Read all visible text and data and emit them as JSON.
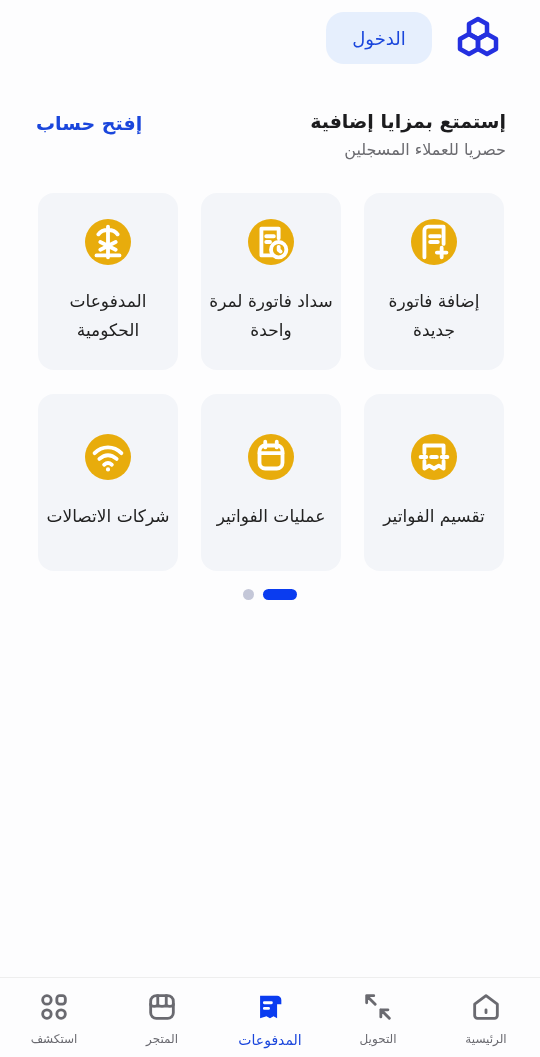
{
  "header": {
    "login_button": "الدخول"
  },
  "promo": {
    "title": "إستمتع بمزايا إضافية",
    "subtitle": "حصريا للعملاء المسجلين",
    "link": "إفتح حساب"
  },
  "services": [
    {
      "label": "إضافة فاتورة جديدة"
    },
    {
      "label": "سداد فاتورة لمرة واحدة"
    },
    {
      "label": "المدفوعات الحكومية"
    },
    {
      "label": "تقسيم الفواتير"
    },
    {
      "label": "عمليات الفواتير"
    },
    {
      "label": "شركات الاتصالات"
    }
  ],
  "pager": [
    {
      "selected": true
    },
    {
      "selected": false
    }
  ],
  "bottom_nav": [
    {
      "label": "الرئيسية",
      "selected": false
    },
    {
      "label": "التحويل",
      "selected": false
    },
    {
      "label": "المدفوعات",
      "selected": true
    },
    {
      "label": "المتجر",
      "selected": false
    },
    {
      "label": "استكشف",
      "selected": false
    }
  ]
}
